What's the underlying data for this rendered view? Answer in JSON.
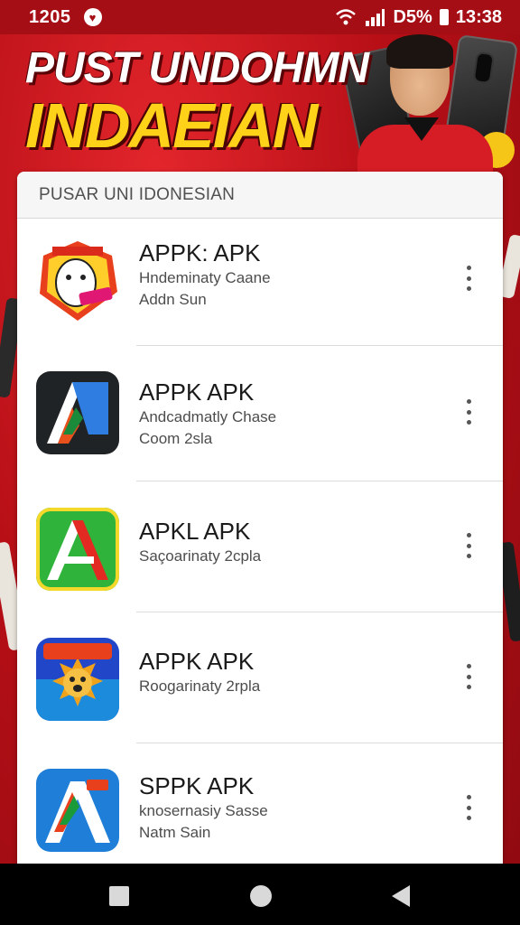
{
  "status_bar": {
    "time": "1205",
    "battery_text": "D5%",
    "clock": "13:38",
    "notification_icon": "heart-icon",
    "wifi_icon": "wifi-icon",
    "signal_icon": "signal-icon",
    "battery_icon": "battery-icon"
  },
  "banner": {
    "line1": "PUST UNDOHMN",
    "line2": "INDAEIAN"
  },
  "list": {
    "header": "PUSAR UNI IDONESIAN",
    "apps": [
      {
        "name": "APPK: APK",
        "desc1": "Hndeminaty Caane",
        "desc2": "Addn Sun",
        "icon": "ghost-badge-icon"
      },
      {
        "name": "APPK APK",
        "desc1": "Andcadmatly Chase",
        "desc2": "Coom 2sla",
        "icon": "letter-a-dark-icon"
      },
      {
        "name": "APKL APK",
        "desc1": "Saçoarinaty 2cpla",
        "desc2": "",
        "icon": "letter-a-green-icon"
      },
      {
        "name": "APPK APK",
        "desc1": "Roogarinaty 2rpla",
        "desc2": "",
        "icon": "sun-face-icon"
      },
      {
        "name": "SPPK APK",
        "desc1": "knosernasiy Sasse",
        "desc2": "Natm Sain",
        "icon": "letter-a-blue-icon"
      }
    ]
  },
  "nav": {
    "recent_icon": "square-icon",
    "home_icon": "circle-icon",
    "back_icon": "triangle-back-icon"
  },
  "colors": {
    "brand_red": "#c8141c",
    "banner_yellow": "#ffd21a",
    "card_bg": "#ffffff"
  }
}
